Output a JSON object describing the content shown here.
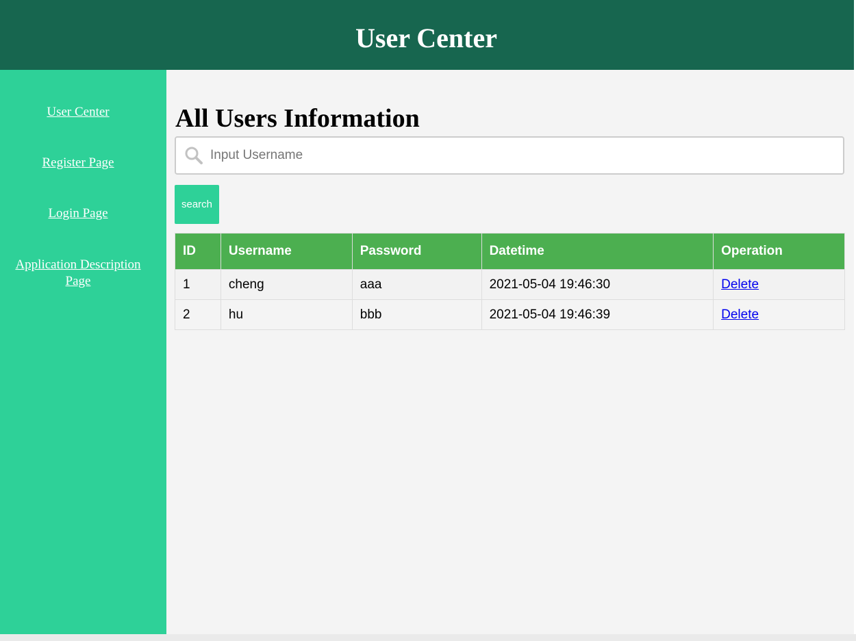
{
  "header": {
    "title": "User Center"
  },
  "sidebar": {
    "items": [
      {
        "label": "User Center"
      },
      {
        "label": "Register Page"
      },
      {
        "label": "Login Page"
      },
      {
        "label": "Application Description"
      },
      {
        "label": "Page"
      }
    ]
  },
  "main": {
    "title": "All Users Information",
    "search": {
      "placeholder": "Input Username",
      "value": "",
      "icon": "search-icon"
    },
    "search_button": "search",
    "table": {
      "headers": [
        "ID",
        "Username",
        "Password",
        "Datetime",
        "Operation"
      ],
      "rows": [
        {
          "id": "1",
          "username": "cheng",
          "password": "aaa",
          "datetime": "2021-05-04 19:46:30",
          "operation": "Delete"
        },
        {
          "id": "2",
          "username": "hu",
          "password": "bbb",
          "datetime": "2021-05-04 19:46:39",
          "operation": "Delete"
        }
      ]
    }
  },
  "colors": {
    "header_bg": "#17664f",
    "sidebar_bg": "#2ed198",
    "table_header_bg": "#4caf50",
    "link": "#0000ee"
  }
}
